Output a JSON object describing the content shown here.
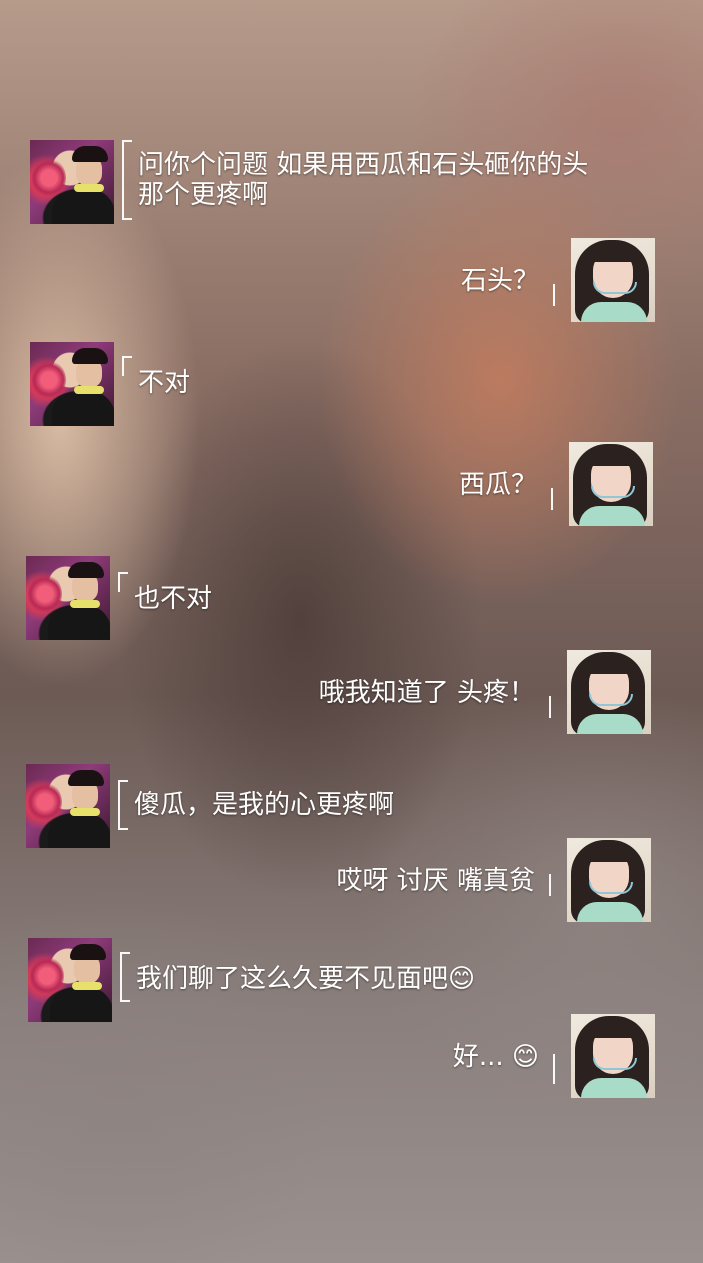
{
  "messages": [
    {
      "side": "left",
      "text": "问你个问题 如果用西瓜和石头砸你的头\n那个更疼啊"
    },
    {
      "side": "right",
      "text": "石头？"
    },
    {
      "side": "left",
      "text": "不对"
    },
    {
      "side": "right",
      "text": "西瓜？"
    },
    {
      "side": "left",
      "text": "也不对"
    },
    {
      "side": "right",
      "text": "哦我知道了 头疼！"
    },
    {
      "side": "left",
      "text": "傻瓜，是我的心更疼啊"
    },
    {
      "side": "right",
      "text": "哎呀 讨厌 嘴真贫"
    },
    {
      "side": "left",
      "text": "我们聊了这么久要不见面吧😊"
    },
    {
      "side": "right",
      "text": "好...   😊"
    }
  ]
}
